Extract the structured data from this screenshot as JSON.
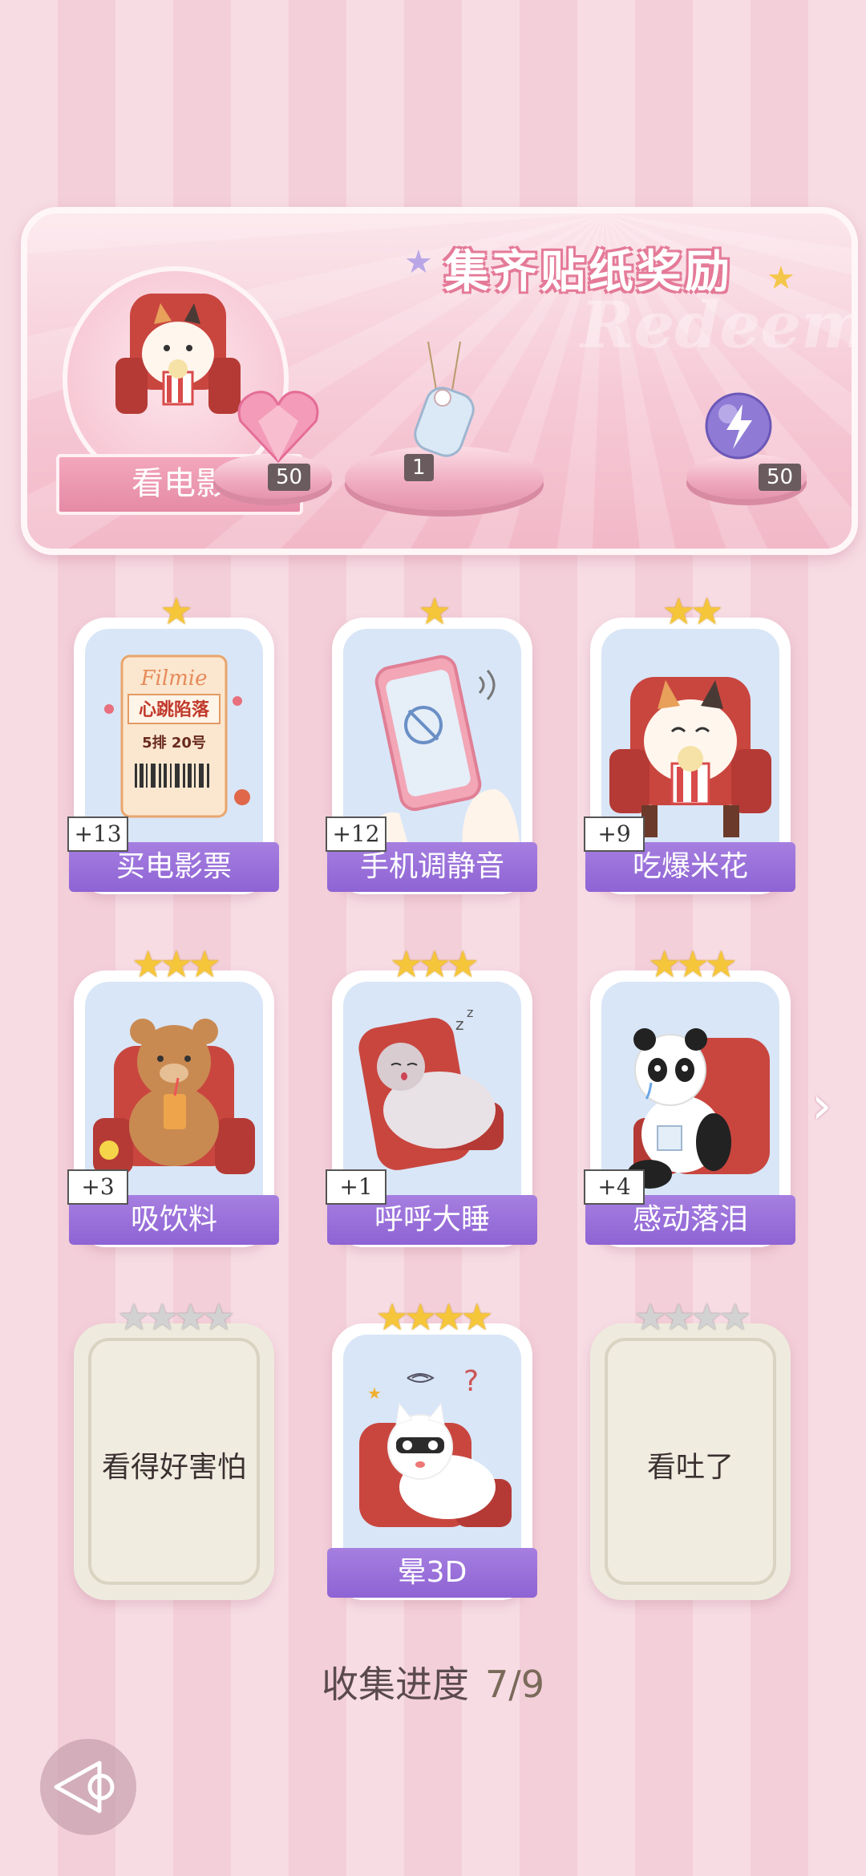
{
  "banner": {
    "title": "集齐贴纸奖励",
    "watermark": "Redeem",
    "theme_label": "看电影",
    "rewards": [
      {
        "icon": "pink-heart-gem-icon",
        "count": "50"
      },
      {
        "icon": "bottle-charm-icon",
        "count": "1"
      },
      {
        "icon": "purple-energy-orb-icon",
        "count": "50"
      }
    ]
  },
  "cards": [
    {
      "name": "买电影票",
      "bonus": "+13",
      "stars": 1,
      "max_stars": 1,
      "icon": "movie-ticket-icon",
      "ticket_brand": "Filmie",
      "ticket_title": "心跳陷落",
      "ticket_seat": "5排 20号",
      "locked": false
    },
    {
      "name": "手机调静音",
      "bonus": "+12",
      "stars": 1,
      "max_stars": 1,
      "icon": "phone-mute-icon",
      "locked": false
    },
    {
      "name": "吃爆米花",
      "bonus": "+9",
      "stars": 2,
      "max_stars": 2,
      "icon": "cat-popcorn-icon",
      "locked": false
    },
    {
      "name": "吸饮料",
      "bonus": "+3",
      "stars": 3,
      "max_stars": 3,
      "icon": "bear-drink-icon",
      "locked": false
    },
    {
      "name": "呼呼大睡",
      "bonus": "+1",
      "stars": 3,
      "max_stars": 3,
      "icon": "hamster-sleep-icon",
      "locked": false
    },
    {
      "name": "感动落泪",
      "bonus": "+4",
      "stars": 3,
      "max_stars": 3,
      "icon": "panda-crying-icon",
      "locked": false
    },
    {
      "name": "看得好害怕",
      "bonus": "",
      "stars": 0,
      "max_stars": 4,
      "icon": "locked-card-icon",
      "locked": true
    },
    {
      "name": "晕3D",
      "bonus": "",
      "stars": 4,
      "max_stars": 4,
      "icon": "cat-3d-dizzy-icon",
      "locked": false
    },
    {
      "name": "看吐了",
      "bonus": "",
      "stars": 0,
      "max_stars": 4,
      "icon": "locked-card-icon",
      "locked": true
    }
  ],
  "progress": {
    "label": "收集进度",
    "value": "7/9"
  },
  "colors": {
    "accent_purple": "#8e63d4",
    "banner_pink": "#f2b8c8",
    "star_gold": "#f6c63a"
  }
}
